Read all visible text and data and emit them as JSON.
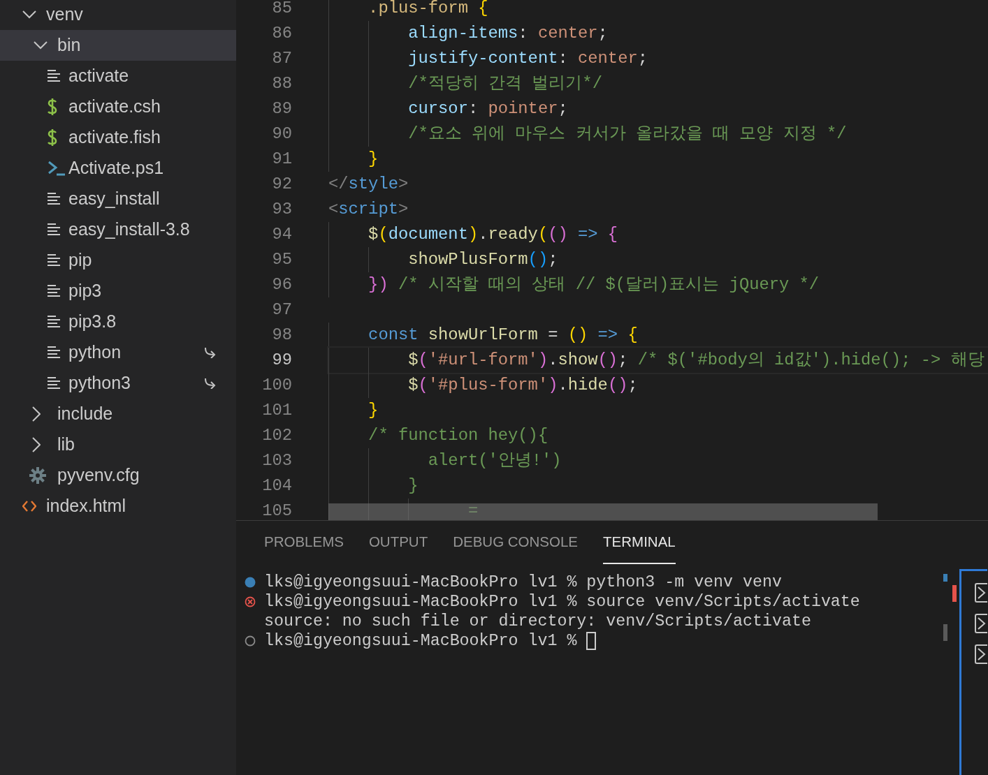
{
  "explorer": {
    "items": [
      {
        "label": "venv",
        "kind": "folder",
        "expanded": true,
        "selected": false,
        "children": [
          {
            "label": "bin",
            "kind": "folder",
            "expanded": true,
            "selected": true,
            "children": [
              {
                "label": "activate",
                "kind": "text",
                "selected": false
              },
              {
                "label": "activate.csh",
                "kind": "shell",
                "selected": false
              },
              {
                "label": "activate.fish",
                "kind": "shell",
                "selected": false
              },
              {
                "label": "Activate.ps1",
                "kind": "powershell",
                "selected": false
              },
              {
                "label": "easy_install",
                "kind": "text",
                "selected": false
              },
              {
                "label": "easy_install-3.8",
                "kind": "text",
                "selected": false
              },
              {
                "label": "pip",
                "kind": "text",
                "selected": false
              },
              {
                "label": "pip3",
                "kind": "text",
                "selected": false
              },
              {
                "label": "pip3.8",
                "kind": "text",
                "selected": false
              },
              {
                "label": "python",
                "kind": "text",
                "selected": false,
                "symlink": true
              },
              {
                "label": "python3",
                "kind": "text",
                "selected": false,
                "symlink": true
              }
            ]
          },
          {
            "label": "include",
            "kind": "folder",
            "expanded": false,
            "selected": false
          },
          {
            "label": "lib",
            "kind": "folder",
            "expanded": false,
            "selected": false
          },
          {
            "label": "pyvenv.cfg",
            "kind": "config",
            "selected": false
          }
        ]
      },
      {
        "label": "index.html",
        "kind": "html",
        "selected": false
      }
    ]
  },
  "editor": {
    "lines": [
      {
        "number": "85",
        "current": false,
        "tokens": [
          {
            "text": "    .plus-form",
            "kind": "selector"
          },
          {
            "text": " {",
            "kind": "brace"
          }
        ]
      },
      {
        "number": "86",
        "current": false,
        "tokens": [
          {
            "text": "        align-items",
            "kind": "property"
          },
          {
            "text": ": ",
            "kind": "punct"
          },
          {
            "text": "center",
            "kind": "string"
          },
          {
            "text": ";",
            "kind": "punct"
          }
        ]
      },
      {
        "number": "87",
        "current": false,
        "tokens": [
          {
            "text": "        justify-content",
            "kind": "property"
          },
          {
            "text": ": ",
            "kind": "punct"
          },
          {
            "text": "center",
            "kind": "string"
          },
          {
            "text": ";",
            "kind": "punct"
          }
        ]
      },
      {
        "number": "88",
        "current": false,
        "tokens": [
          {
            "text": "        /*적당히 간격 벌리기*/",
            "kind": "comment"
          }
        ]
      },
      {
        "number": "89",
        "current": false,
        "tokens": [
          {
            "text": "        cursor",
            "kind": "property"
          },
          {
            "text": ": ",
            "kind": "punct"
          },
          {
            "text": "pointer",
            "kind": "string"
          },
          {
            "text": ";",
            "kind": "punct"
          }
        ]
      },
      {
        "number": "90",
        "current": false,
        "tokens": [
          {
            "text": "        /*요소 위에 마우스 커서가 올라갔을 때 모양 지정 */",
            "kind": "comment"
          }
        ]
      },
      {
        "number": "91",
        "current": false,
        "tokens": [
          {
            "text": "    }",
            "kind": "brace"
          }
        ]
      },
      {
        "number": "92",
        "current": false,
        "tokens": [
          {
            "text": "</",
            "kind": "tag-punct"
          },
          {
            "text": "style",
            "kind": "tag"
          },
          {
            "text": ">",
            "kind": "tag-punct"
          }
        ]
      },
      {
        "number": "93",
        "current": false,
        "tokens": [
          {
            "text": "<",
            "kind": "tag-punct"
          },
          {
            "text": "script",
            "kind": "tag"
          },
          {
            "text": ">",
            "kind": "tag-punct"
          }
        ]
      },
      {
        "number": "94",
        "current": false,
        "tokens": [
          {
            "text": "    $",
            "kind": "function"
          },
          {
            "text": "(",
            "kind": "brace"
          },
          {
            "text": "document",
            "kind": "property"
          },
          {
            "text": ")",
            "kind": "brace"
          },
          {
            "text": ".",
            "kind": "punct"
          },
          {
            "text": "ready",
            "kind": "function"
          },
          {
            "text": "(",
            "kind": "brace"
          },
          {
            "text": "()",
            "kind": "paren"
          },
          {
            "text": " =>",
            "kind": "keyword"
          },
          {
            "text": " {",
            "kind": "paren"
          }
        ]
      },
      {
        "number": "95",
        "current": false,
        "tokens": [
          {
            "text": "        showPlusForm",
            "kind": "function"
          },
          {
            "text": "()",
            "kind": "paren2"
          },
          {
            "text": ";",
            "kind": "punct"
          }
        ]
      },
      {
        "number": "96",
        "current": false,
        "tokens": [
          {
            "text": "    })",
            "kind": "paren"
          },
          {
            "text": " /* 시작할 때의 상태 // $(달러)표시는 jQuery */",
            "kind": "comment"
          }
        ]
      },
      {
        "number": "97",
        "current": false
      },
      {
        "number": "98",
        "current": false,
        "tokens": [
          {
            "text": "    const",
            "kind": "keyword"
          },
          {
            "text": " showUrlForm",
            "kind": "function"
          },
          {
            "text": " = ",
            "kind": "punct"
          },
          {
            "text": "()",
            "kind": "brace"
          },
          {
            "text": " =>",
            "kind": "keyword"
          },
          {
            "text": " {",
            "kind": "brace"
          }
        ]
      },
      {
        "number": "99",
        "current": true,
        "tokens": [
          {
            "text": "        $",
            "kind": "function"
          },
          {
            "text": "(",
            "kind": "paren"
          },
          {
            "text": "'#url-form'",
            "kind": "string"
          },
          {
            "text": ")",
            "kind": "paren"
          },
          {
            "text": ".",
            "kind": "punct"
          },
          {
            "text": "show",
            "kind": "function"
          },
          {
            "text": "()",
            "kind": "paren"
          },
          {
            "text": "; ",
            "kind": "punct"
          },
          {
            "text": "/* $('#body의 id값').hide(); -> 해당",
            "kind": "comment"
          }
        ]
      },
      {
        "number": "100",
        "current": false,
        "tokens": [
          {
            "text": "        $",
            "kind": "function"
          },
          {
            "text": "(",
            "kind": "paren"
          },
          {
            "text": "'#plus-form'",
            "kind": "string"
          },
          {
            "text": ")",
            "kind": "paren"
          },
          {
            "text": ".",
            "kind": "punct"
          },
          {
            "text": "hide",
            "kind": "function"
          },
          {
            "text": "()",
            "kind": "paren"
          },
          {
            "text": ";",
            "kind": "punct"
          }
        ]
      },
      {
        "number": "101",
        "current": false,
        "tokens": [
          {
            "text": "    }",
            "kind": "brace"
          }
        ]
      },
      {
        "number": "102",
        "current": false,
        "tokens": [
          {
            "text": "    /* function hey(){",
            "kind": "comment"
          }
        ]
      },
      {
        "number": "103",
        "current": false,
        "tokens": [
          {
            "text": "          alert('안녕!')",
            "kind": "comment"
          }
        ]
      },
      {
        "number": "104",
        "current": false,
        "tokens": [
          {
            "text": "        }",
            "kind": "comment"
          }
        ]
      },
      {
        "number": "105",
        "current": false,
        "tokens": [
          {
            "text": "              =",
            "kind": "comment"
          }
        ]
      }
    ]
  },
  "panel": {
    "tabs": [
      {
        "label": "PROBLEMS",
        "selected": false
      },
      {
        "label": "OUTPUT",
        "selected": false
      },
      {
        "label": "DEBUG CONSOLE",
        "selected": false
      },
      {
        "label": "TERMINAL",
        "selected": true
      }
    ],
    "terminal": {
      "lines": [
        {
          "kind": "success",
          "text": "lks@igyeongsuui-MacBookPro lv1 % python3 -m venv venv"
        },
        {
          "kind": "error",
          "text": "lks@igyeongsuui-MacBookPro lv1 % source venv/Scripts/activate"
        },
        {
          "text": "source: no such file or directory: venv/Scripts/activate"
        },
        {
          "kind": "pending",
          "text": "lks@igyeongsuui-MacBookPro lv1 % ",
          "cursor": true
        }
      ]
    }
  }
}
